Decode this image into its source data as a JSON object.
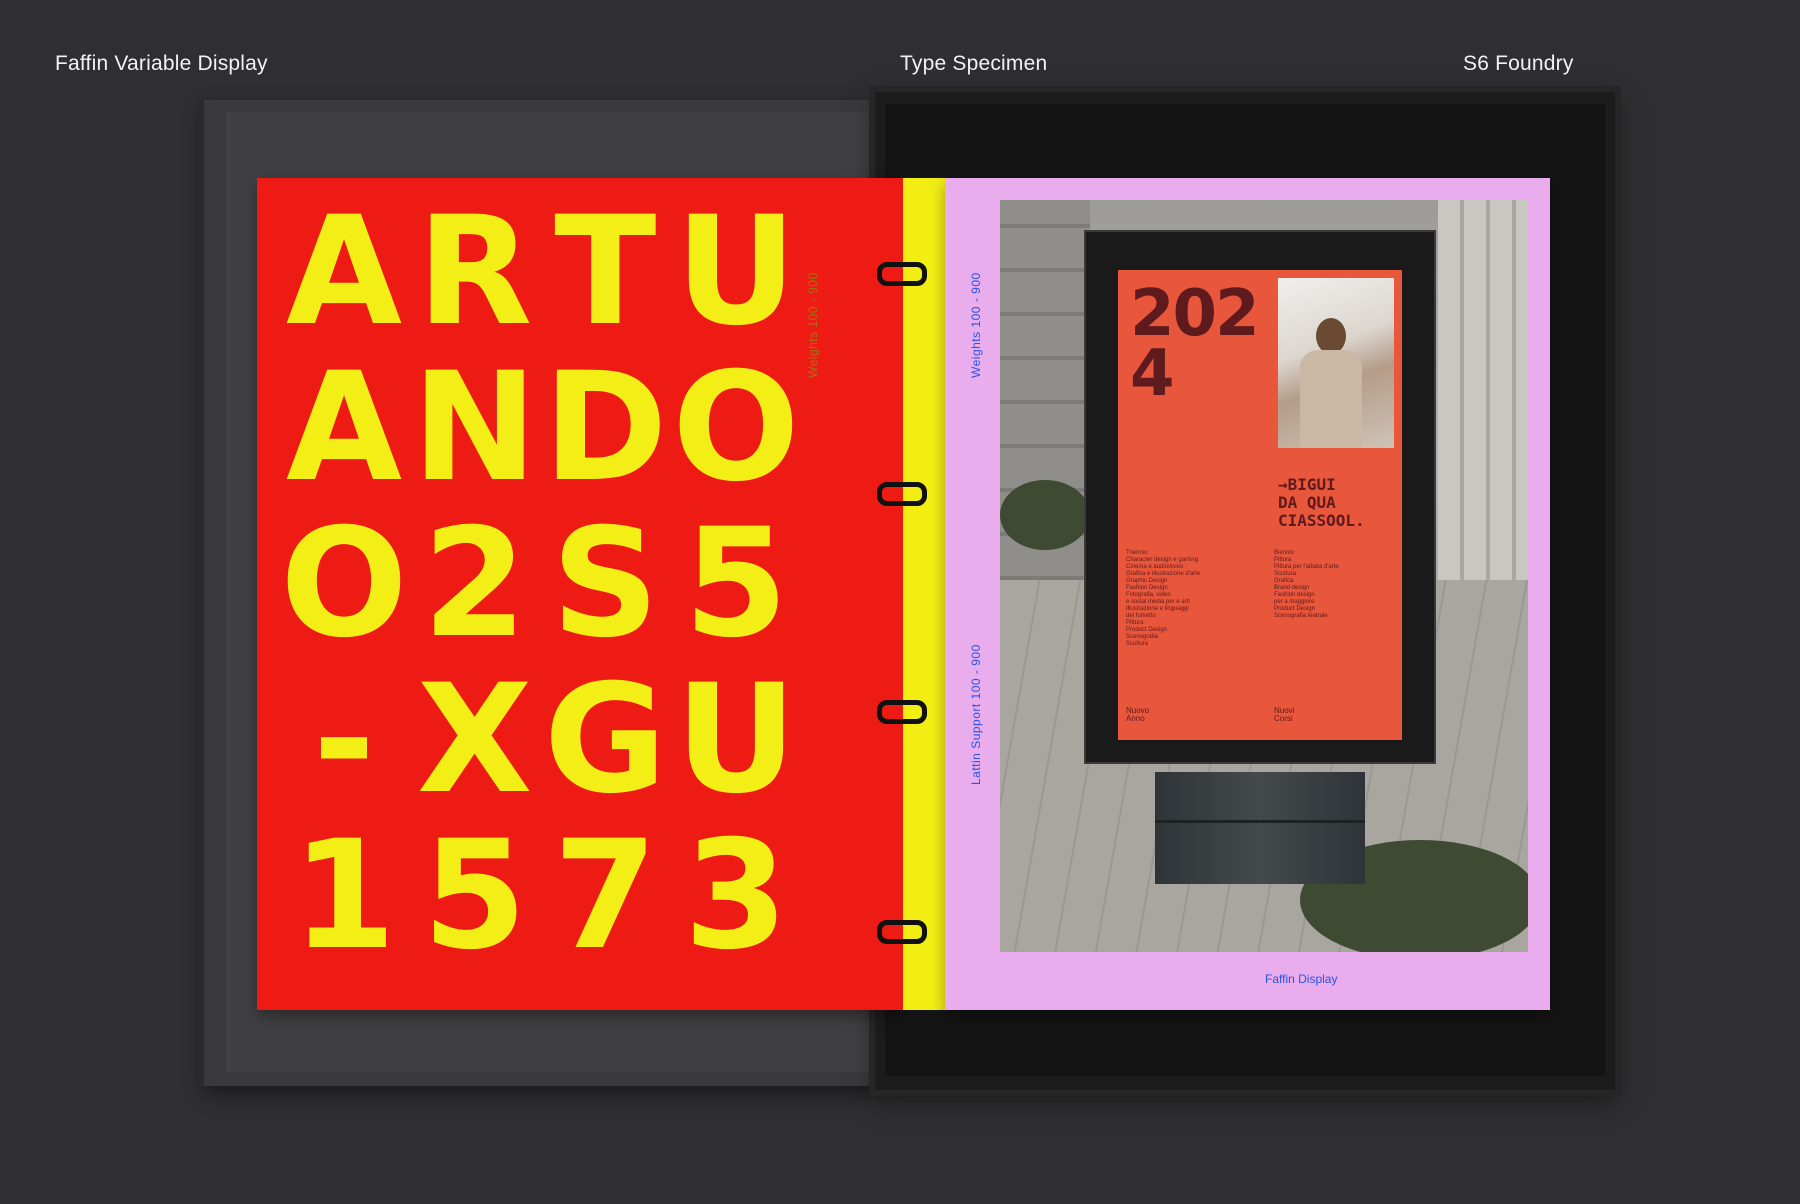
{
  "header": {
    "left": "Faffin Variable Display",
    "center": "Type Specimen",
    "right": "S6 Foundry"
  },
  "left_page": {
    "glyph_rows": [
      [
        "A",
        "R",
        "T",
        "U"
      ],
      [
        "A",
        "N",
        "D",
        "O"
      ],
      [
        "O",
        "2",
        "S",
        "5"
      ],
      [
        "-",
        "X",
        "G",
        "U"
      ],
      [
        "1",
        "5",
        "7",
        "3"
      ]
    ],
    "side_label": "Weights 100 - 900",
    "colors": {
      "background": "#ee1b14",
      "glyph": "#f3ef16"
    }
  },
  "right_page": {
    "side_label_top": "Weights 100 - 900",
    "side_label_bottom": "Lattin Support 100 - 900",
    "footer": "Faffin Display",
    "color": "#e9acec",
    "poster": {
      "year": "2024",
      "arrow_line": "→BIGUI\nDA QUA\nCIASSOOL.",
      "column1": "Triennio\nCharacter design e gaming\nCinema e audiovisivo\nGrafica e illustrazione d'arte\nGraphic Design\nFashion Design\nFotografia, video\ne social media per e arti\nIllustrazione e linguaggi\ndel fumetto\nPittura\nProduct Design\nScenografia\nScultura",
      "column2": "Biennio\nPittura\nPittura per l'albata d'arte\nScultura\nGrafica\nBrand design\nFashion design\nper a maggiore\nProduct Design\nScenografia teatrale",
      "footer_left": "Nuovo\nAnno",
      "footer_right": "Nuovi\nCorsi"
    }
  }
}
